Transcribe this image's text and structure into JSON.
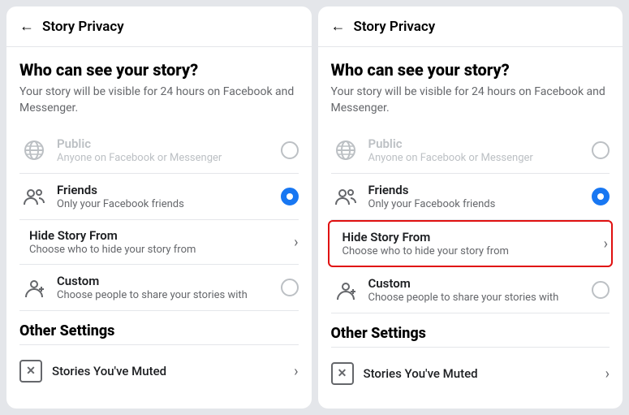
{
  "panels": [
    {
      "id": "left",
      "header": {
        "back_label": "←",
        "title": "Story Privacy"
      },
      "section": {
        "title": "Who can see your story?",
        "description": "Your story will be visible for 24 hours on Facebook and Messenger."
      },
      "options": [
        {
          "id": "public",
          "label": "Public",
          "sublabel": "Anyone on Facebook or Messenger",
          "type": "radio",
          "selected": false,
          "disabled": true,
          "icon": "globe"
        },
        {
          "id": "friends",
          "label": "Friends",
          "sublabel": "Only your Facebook friends",
          "type": "radio",
          "selected": true,
          "disabled": false,
          "icon": "friends"
        },
        {
          "id": "hide-story-from",
          "label": "Hide Story From",
          "sublabel": "Choose who to hide your story from",
          "type": "chevron",
          "selected": false,
          "disabled": false,
          "highlighted": false,
          "icon": "none"
        },
        {
          "id": "custom",
          "label": "Custom",
          "sublabel": "Choose people to share your stories with",
          "type": "radio",
          "selected": false,
          "disabled": false,
          "icon": "custom"
        }
      ],
      "other_settings": {
        "title": "Other Settings",
        "items": [
          {
            "id": "stories-muted",
            "label": "Stories You've Muted",
            "icon": "muted-x"
          }
        ]
      }
    },
    {
      "id": "right",
      "header": {
        "back_label": "←",
        "title": "Story Privacy"
      },
      "section": {
        "title": "Who can see your story?",
        "description": "Your story will be visible for 24 hours on Facebook and Messenger."
      },
      "options": [
        {
          "id": "public",
          "label": "Public",
          "sublabel": "Anyone on Facebook or Messenger",
          "type": "radio",
          "selected": false,
          "disabled": true,
          "icon": "globe"
        },
        {
          "id": "friends",
          "label": "Friends",
          "sublabel": "Only your Facebook friends",
          "type": "radio",
          "selected": true,
          "disabled": false,
          "icon": "friends"
        },
        {
          "id": "hide-story-from",
          "label": "Hide Story From",
          "sublabel": "Choose who to hide your story from",
          "type": "chevron",
          "selected": false,
          "disabled": false,
          "highlighted": true,
          "icon": "none"
        },
        {
          "id": "custom",
          "label": "Custom",
          "sublabel": "Choose people to share your stories with",
          "type": "radio",
          "selected": false,
          "disabled": false,
          "icon": "custom"
        }
      ],
      "other_settings": {
        "title": "Other Settings",
        "items": [
          {
            "id": "stories-muted",
            "label": "Stories You've Muted",
            "icon": "muted-x"
          }
        ]
      }
    }
  ]
}
